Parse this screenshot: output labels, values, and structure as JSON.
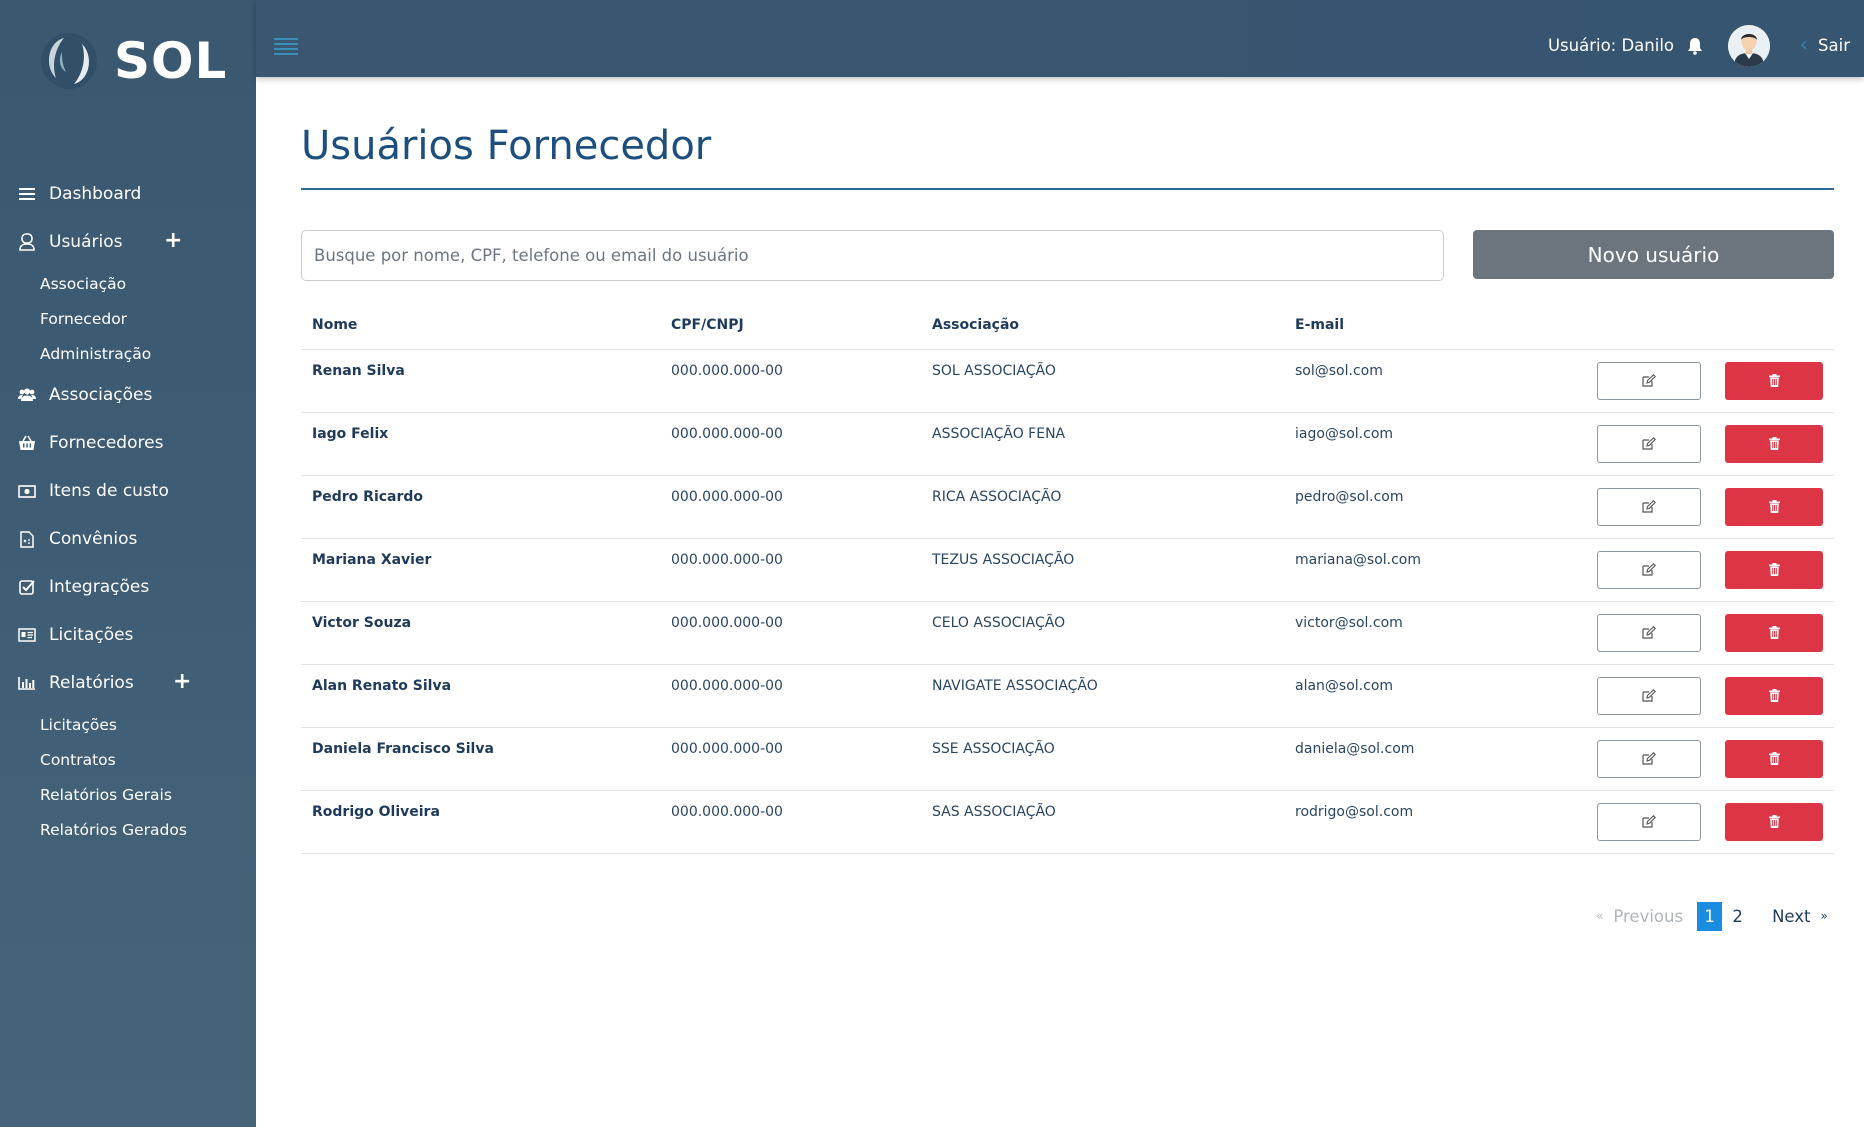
{
  "brand": {
    "name": "SOL"
  },
  "sidebar": {
    "items": [
      {
        "label": "Dashboard",
        "icon": "bars-icon"
      },
      {
        "label": "Usuários",
        "icon": "user-icon",
        "expandable": true,
        "children": [
          "Associação",
          "Fornecedor",
          "Administração"
        ]
      },
      {
        "label": "Associações",
        "icon": "users-icon"
      },
      {
        "label": "Fornecedores",
        "icon": "basket-icon"
      },
      {
        "label": "Itens de custo",
        "icon": "money-icon"
      },
      {
        "label": "Convênios",
        "icon": "document-icon"
      },
      {
        "label": "Integrações",
        "icon": "checkbox-icon"
      },
      {
        "label": "Licitações",
        "icon": "id-card-icon"
      },
      {
        "label": "Relatórios",
        "icon": "bar-chart-icon",
        "expandable": true,
        "children": [
          "Licitações",
          "Contratos",
          "Relatórios Gerais",
          "Relatórios Gerados"
        ]
      }
    ],
    "expand_symbol": "+"
  },
  "topbar": {
    "user_label": "Usuário: Danilo",
    "logout_label": "Sair"
  },
  "main": {
    "title": "Usuários Fornecedor",
    "search_placeholder": "Busque por nome, CPF, telefone ou email do usuário",
    "new_button_label": "Novo usuário",
    "table": {
      "columns": [
        "Nome",
        "CPF/CNPJ",
        "Associação",
        "E-mail"
      ],
      "rows": [
        {
          "name": "Renan Silva",
          "doc": "000.000.000-00",
          "assoc": "SOL ASSOCIAÇÃO",
          "email": "sol@sol.com"
        },
        {
          "name": "Iago Felix",
          "doc": "000.000.000-00",
          "assoc": "ASSOCIAÇÃO FENA",
          "email": "iago@sol.com"
        },
        {
          "name": "Pedro Ricardo",
          "doc": "000.000.000-00",
          "assoc": "RICA ASSOCIAÇÃO",
          "email": "pedro@sol.com"
        },
        {
          "name": "Mariana Xavier",
          "doc": "000.000.000-00",
          "assoc": "TEZUS ASSOCIAÇÃO",
          "email": "mariana@sol.com"
        },
        {
          "name": "Victor Souza",
          "doc": "000.000.000-00",
          "assoc": "CELO ASSOCIAÇÃO",
          "email": "victor@sol.com"
        },
        {
          "name": "Alan Renato Silva",
          "doc": "000.000.000-00",
          "assoc": "NAVIGATE ASSOCIAÇÃO",
          "email": "alan@sol.com"
        },
        {
          "name": "Daniela Francisco Silva",
          "doc": "000.000.000-00",
          "assoc": "SSE ASSOCIAÇÃO",
          "email": "daniela@sol.com"
        },
        {
          "name": "Rodrigo Oliveira",
          "doc": "000.000.000-00",
          "assoc": "SAS ASSOCIAÇÃO",
          "email": "rodrigo@sol.com"
        }
      ],
      "row_actions": {
        "edit_icon": "edit-icon",
        "delete_icon": "trash-icon"
      }
    },
    "pagination": {
      "prev_symbol": "«",
      "prev_label": "Previous",
      "pages": [
        "1",
        "2"
      ],
      "current_page": "1",
      "next_label": "Next",
      "next_symbol": "»"
    }
  },
  "colors": {
    "sidebar_bg": "#3d5b73",
    "title": "#1d4f7e",
    "primary": "#1a8de0",
    "danger": "#dc3545",
    "secondary": "#6c757d"
  }
}
